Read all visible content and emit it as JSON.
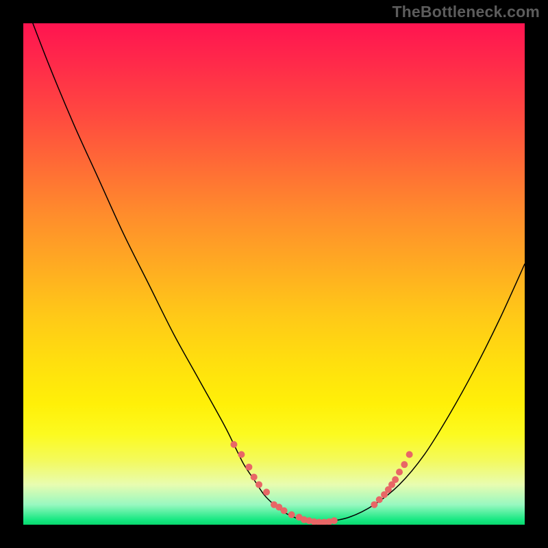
{
  "watermark": "TheBottleneck.com",
  "chart_data": {
    "type": "line",
    "title": "",
    "xlabel": "",
    "ylabel": "",
    "xlim": [
      0,
      100
    ],
    "ylim": [
      0,
      100
    ],
    "grid": false,
    "legend": false,
    "series": [
      {
        "name": "bottleneck-curve",
        "color": "#000000",
        "stroke_width": 1.5,
        "x": [
          0,
          5,
          10,
          15,
          20,
          25,
          30,
          35,
          40,
          42,
          44,
          46,
          48,
          50,
          52,
          54,
          56,
          58,
          60,
          65,
          70,
          75,
          80,
          85,
          90,
          95,
          100
        ],
        "y": [
          105,
          92,
          80,
          69,
          58,
          48,
          38,
          29,
          20,
          16,
          12,
          9,
          6,
          4,
          2.5,
          1.5,
          0.8,
          0.5,
          0.5,
          1.5,
          4,
          8,
          14,
          22,
          31,
          41,
          52
        ]
      },
      {
        "name": "highlight-dots-left",
        "color": "#e86666",
        "marker": "dot",
        "marker_size": 10,
        "x": [
          42,
          43.5,
          45,
          46,
          47,
          48.5,
          50,
          51,
          52,
          53.5,
          55,
          56,
          57,
          58,
          59,
          60,
          61,
          62
        ],
        "y": [
          16,
          14,
          11.5,
          9.5,
          8,
          6.5,
          4,
          3.5,
          2.8,
          2,
          1.5,
          1,
          0.8,
          0.6,
          0.5,
          0.5,
          0.6,
          0.8
        ]
      },
      {
        "name": "highlight-dots-right",
        "color": "#e86666",
        "marker": "dot",
        "marker_size": 10,
        "x": [
          70,
          71,
          72,
          72.8,
          73.5,
          74.2,
          75,
          76,
          77
        ],
        "y": [
          4,
          5,
          6,
          7,
          8,
          9,
          10.5,
          12,
          14
        ]
      }
    ],
    "background": {
      "type": "vertical-gradient",
      "stops": [
        {
          "pos": 0.0,
          "color": "#ff1450"
        },
        {
          "pos": 0.4,
          "color": "#ff8c2c"
        },
        {
          "pos": 0.7,
          "color": "#ffe00e"
        },
        {
          "pos": 0.92,
          "color": "#e8fcb0"
        },
        {
          "pos": 1.0,
          "color": "#08d86e"
        }
      ]
    }
  }
}
